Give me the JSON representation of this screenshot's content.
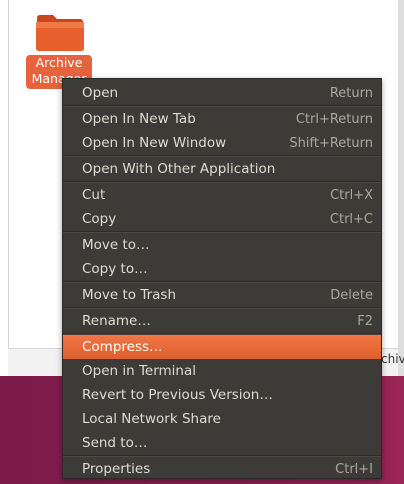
{
  "desktop": {
    "folder": {
      "icon": "folder-icon",
      "label_line1": "Archive",
      "label_line2": "Manager"
    },
    "peek_text": "chiv"
  },
  "context_menu": {
    "highlight_color": "#e8693a",
    "background_color": "#3c3b37",
    "items": [
      {
        "label": "Open",
        "accel": "Return"
      },
      {
        "label": "Open In New Tab",
        "accel": "Ctrl+Return"
      },
      {
        "label": "Open In New Window",
        "accel": "Shift+Return"
      },
      {
        "label": "Open With Other Application",
        "accel": ""
      },
      {
        "label": "Cut",
        "accel": "Ctrl+X"
      },
      {
        "label": "Copy",
        "accel": "Ctrl+C"
      },
      {
        "label": "Move to…",
        "accel": ""
      },
      {
        "label": "Copy to…",
        "accel": ""
      },
      {
        "label": "Move to Trash",
        "accel": "Delete"
      },
      {
        "label": "Rename…",
        "accel": "F2"
      },
      {
        "label": "Compress…",
        "accel": ""
      },
      {
        "label": "Open in Terminal",
        "accel": ""
      },
      {
        "label": "Revert to Previous Version…",
        "accel": ""
      },
      {
        "label": "Local Network Share",
        "accel": ""
      },
      {
        "label": "Send to…",
        "accel": ""
      },
      {
        "label": "Properties",
        "accel": "Ctrl+I"
      }
    ]
  }
}
